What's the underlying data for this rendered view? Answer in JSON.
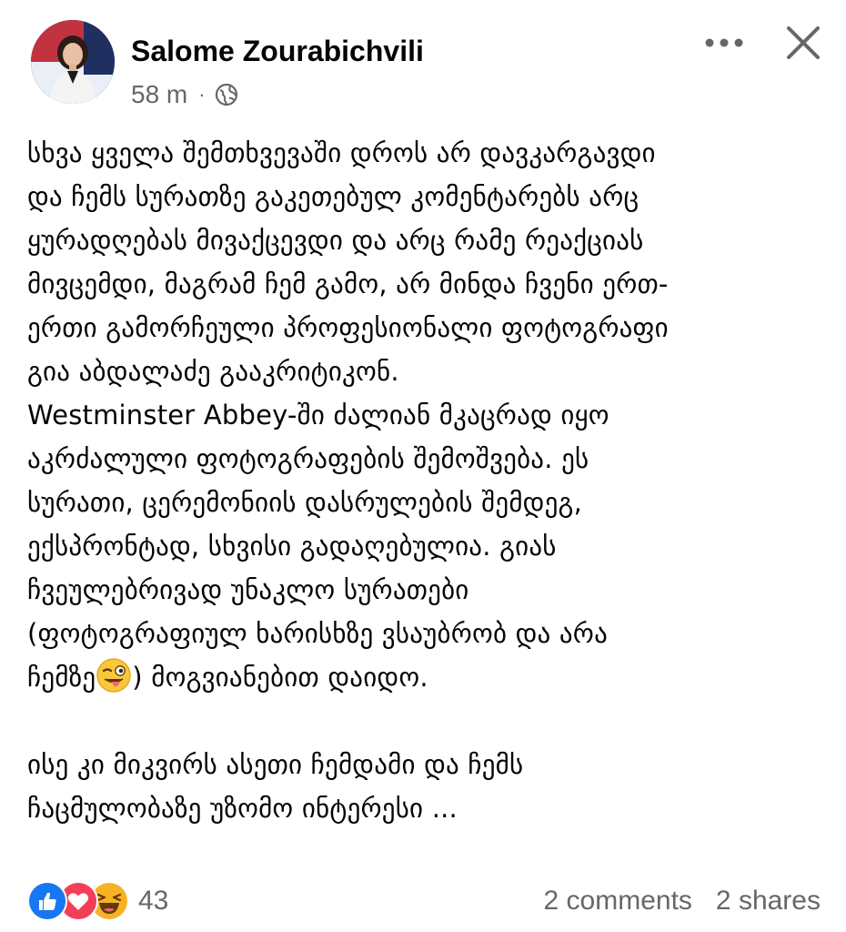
{
  "header": {
    "author_name": "Salome Zourabichvili",
    "timestamp": "58 m",
    "separator": "·",
    "privacy_icon": "globe-icon",
    "more_icon": "more-horizontal-icon",
    "close_icon": "close-icon"
  },
  "post": {
    "paragraph_1": "სხვა ყველა შემთხვევაში დროს არ დავკარგავდი\nდა ჩემს სურათზე გაკეთებულ კომენტარებს არც\nყურადღებას მივაქცევდი და არც რამე რეაქციას\nმივცემდი, მაგრამ ჩემ გამო, არ მინდა ჩვენი ერთ-\nერთი გამორჩეული პროფესიონალი ფოტოგრაფი\nგია აბდალაძე გააკრიტიკონ.",
    "paragraph_2_a": "Westminster Abbey-ში ძალიან მკაცრად იყო\nაკრძალული ფოტოგრაფების შემოშვება.  ეს\nსურათი, ცერემონიის დასრულების შემდეგ,\nექსპრონტად, სხვისი გადაღებულია. გიას\nჩვეულებრივად უნაკლო სურათები\n(ფოტოგრაფიულ ხარისხზე ვსაუბრობ და არა\nჩემზე",
    "emoji": "winking-face-with-tongue",
    "paragraph_2_b": ")  მოგვიანებით დაიდო.",
    "paragraph_3": "ისე კი მიკვირს ასეთი ჩემდამი და ჩემს\nჩაცმულობაზე უზომო ინტერესი ..."
  },
  "footer": {
    "reaction_icons": [
      "like-icon",
      "love-icon",
      "haha-icon"
    ],
    "reaction_count": "43",
    "comments": "2 comments",
    "shares": "2 shares"
  },
  "colors": {
    "text": "#050505",
    "secondary": "#65676b",
    "like": "#1877f2",
    "love": "#f33e58",
    "haha": "#f7b125"
  }
}
